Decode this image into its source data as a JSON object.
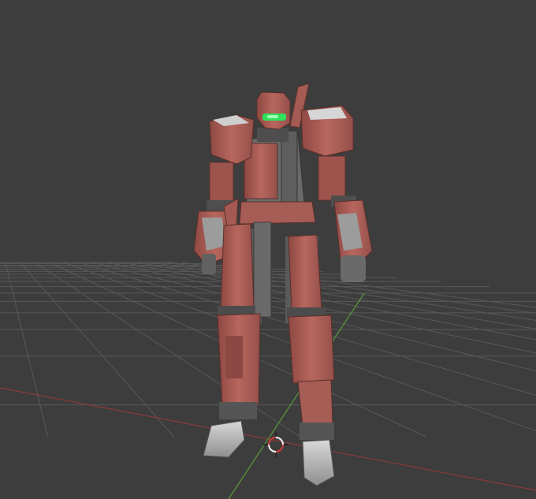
{
  "viewport": {
    "name": "3D Viewport",
    "background_color": "#3d3d3d",
    "grid_line_color": "#595959",
    "x_axis_color": "#8a3a3a",
    "y_axis_color": "#5a9a3a"
  },
  "scene": {
    "object": "mech-robot",
    "armor_color": "#b8675e",
    "armor_shadow_color": "#7c3d38",
    "frame_color": "#5e5e5e",
    "joint_color": "#4a4a4a",
    "visor_color": "#2fe05a",
    "foot_color": "#bdbdbd"
  },
  "cursor_3d": {
    "name": "3d-cursor",
    "ring_color_a": "#d23b3b",
    "ring_color_b": "#f2f2f2"
  }
}
